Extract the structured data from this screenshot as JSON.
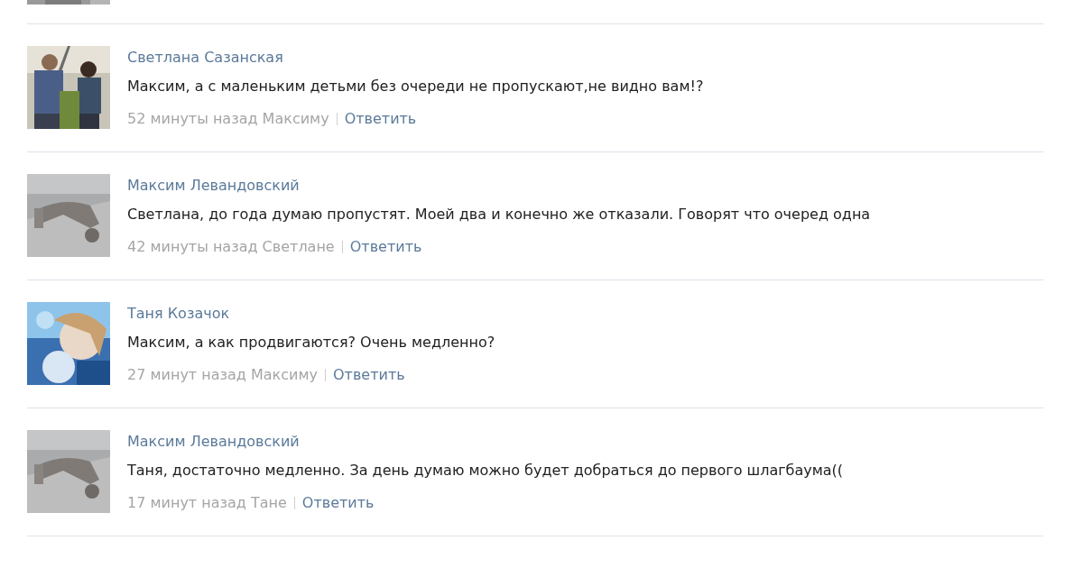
{
  "comments": [
    {
      "author": "Светлана Сазанская",
      "text": "Максим, а с маленьким детьми без очереди не пропускают,не видно вам!?",
      "time": "52 минуты назад Максиму",
      "reply": "Ответить"
    },
    {
      "author": "Максим Левандовский",
      "text": "Светлана, до года думаю пропустят. Моей два и конечно же отказали. Говорят что очеред одна",
      "time": "42 минуты назад Светлане",
      "reply": "Ответить"
    },
    {
      "author": "Таня Козачок",
      "text": "Максим, а как продвигаются? Очень медленно?",
      "time": "27 минут назад Максиму",
      "reply": "Ответить"
    },
    {
      "author": "Максим Левандовский",
      "text": "Таня, достаточно медленно. За день думаю можно будет добраться до первого шлагбаума((",
      "time": "17 минут назад Тане",
      "reply": "Ответить"
    }
  ]
}
